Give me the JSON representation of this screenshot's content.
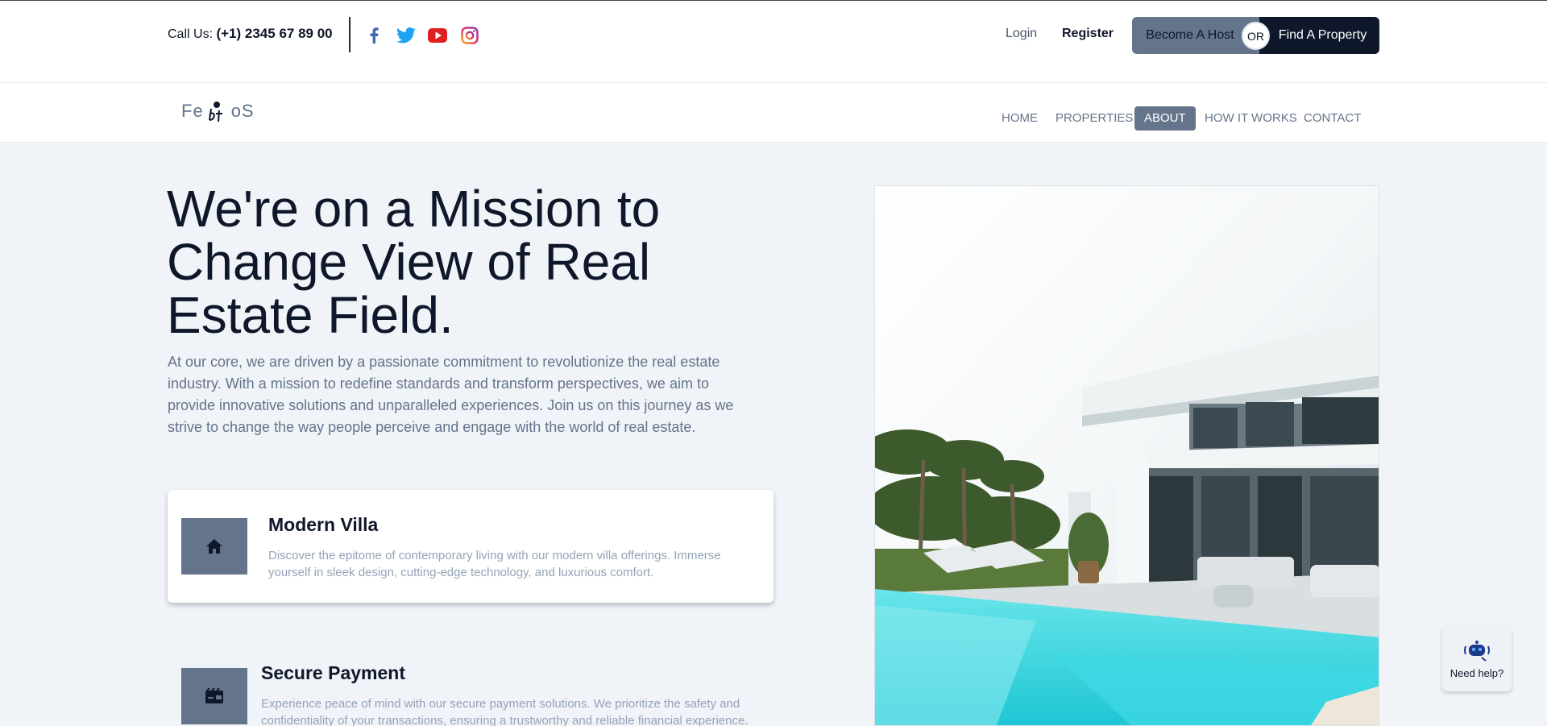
{
  "topbar": {
    "call_label": "Call Us:",
    "phone": "(+1) 2345 67 89 00",
    "social": [
      "facebook-icon",
      "twitter-icon",
      "youtube-icon",
      "instagram-icon"
    ],
    "login": "Login",
    "register": "Register",
    "become_host": "Become A Host",
    "or": "OR",
    "find_property": "Find A Property"
  },
  "nav": {
    "logo_left": "Fe",
    "logo_right": "oS",
    "items": [
      "HOME",
      "PROPERTIES",
      "ABOUT",
      "HOW IT WORKS",
      "CONTACT"
    ],
    "active": "ABOUT"
  },
  "hero": {
    "headline": "We're on a Mission to Change View of Real Estate Field.",
    "intro": "At our core, we are driven by a passionate commitment to revolutionize the real estate industry. With a mission to redefine standards and transform perspectives, we aim to provide innovative solutions and unparalleled experiences. Join us on this journey as we strive to change the way people perceive and engage with the world of real estate."
  },
  "features": [
    {
      "icon": "home-icon",
      "title": "Modern Villa",
      "desc": "Discover the epitome of contemporary living with our modern villa offerings. Immerse yourself in sleek design, cutting-edge technology, and luxurious comfort."
    },
    {
      "icon": "payment-icon",
      "title": "Secure Payment",
      "desc": "Experience peace of mind with our secure payment solutions. We prioritize the safety and confidentiality of your transactions, ensuring a trustworthy and reliable financial experience."
    }
  ],
  "help": {
    "label": "Need help?",
    "icon": "robot-icon"
  },
  "colors": {
    "primary_dark": "#0f172a",
    "slate": "#64748b",
    "background": "#f0f3f7",
    "pool": "#3fd6e0"
  }
}
